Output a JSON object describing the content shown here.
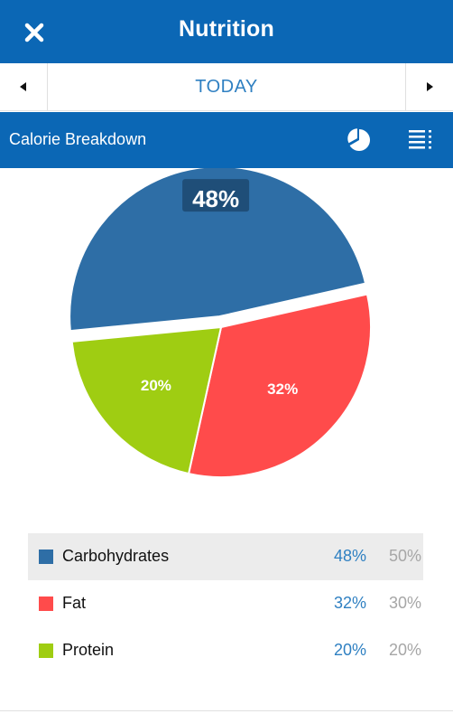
{
  "header": {
    "title": "Nutrition"
  },
  "daynav": {
    "day_label": "TODAY"
  },
  "section": {
    "title": "Calorie Breakdown"
  },
  "colors": {
    "brand_blue": "#0b67b5",
    "link_blue": "#2f80c2",
    "carbohydrates": "#2e6ea6",
    "fat": "#ff4b4b",
    "protein": "#9fcd12",
    "goal_gray": "#a6a6a6"
  },
  "icons": {
    "close": "close-icon",
    "prev_day": "arrow-left-icon",
    "next_day": "arrow-right-icon",
    "pie_view": "pie-chart-icon",
    "list_view": "list-icon"
  },
  "chart_data": {
    "type": "pie",
    "title": "",
    "slices": [
      {
        "name": "Carbohydrates",
        "value": 48,
        "label": "48%",
        "color": "#2e6ea6"
      },
      {
        "name": "Fat",
        "value": 32,
        "label": "32%",
        "color": "#ff4b4b"
      },
      {
        "name": "Protein",
        "value": 20,
        "label": "20%",
        "color": "#9fcd12"
      }
    ],
    "legend_placement": "below"
  },
  "legend": {
    "rows": [
      {
        "name": "Carbohydrates",
        "actual": "48%",
        "goal": "50%",
        "color": "#2e6ea6",
        "selected": true
      },
      {
        "name": "Fat",
        "actual": "32%",
        "goal": "30%",
        "color": "#ff4b4b",
        "selected": false
      },
      {
        "name": "Protein",
        "actual": "20%",
        "goal": "20%",
        "color": "#9fcd12",
        "selected": false
      }
    ]
  }
}
